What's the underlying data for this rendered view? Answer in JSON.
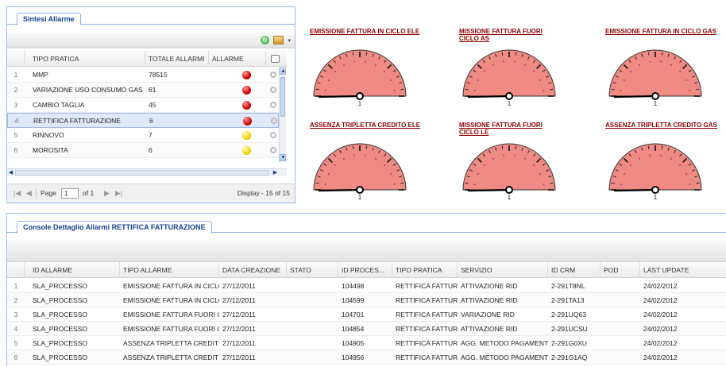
{
  "summary_panel": {
    "tab_label": "Sintesi Allarme",
    "columns": [
      "TIPO PRATICA",
      "TOTALE ALLARMI",
      "ALLARME"
    ],
    "rows": [
      {
        "n": "1",
        "tipo": "MMP",
        "totale": "78515",
        "level": "red"
      },
      {
        "n": "2",
        "tipo": "VARIAZIONE USO CONSUMO GAS",
        "totale": "61",
        "level": "red"
      },
      {
        "n": "3",
        "tipo": "CAMBIO TAGLIA",
        "totale": "45",
        "level": "red"
      },
      {
        "n": "4",
        "tipo": "RETTIFICA FATTURAZIONE",
        "totale": "6",
        "level": "red"
      },
      {
        "n": "5",
        "tipo": "RINNOVO",
        "totale": "7",
        "level": "yellow"
      },
      {
        "n": "6",
        "tipo": "MOROSITA",
        "totale": "6",
        "level": "yellow"
      }
    ],
    "selected_row": 3,
    "pager": {
      "page_label": "Page",
      "page_value": "1",
      "of_label": "of 1",
      "display": "Display - 15 of 15"
    },
    "icons": [
      "refresh-icon",
      "export-icon"
    ]
  },
  "gauges": [
    {
      "title": "EMISSIONE FATTURA IN CICLO ELE",
      "value": "1",
      "level": 0
    },
    {
      "title": "MISSIONE FATTURA FUORI CICLO AS",
      "value": "1",
      "level": 0
    },
    {
      "title": "EMISSIONE FATTURA IN CICLO GAS",
      "value": "1",
      "level": 0
    },
    {
      "title": "ASSENZA TRIPLETTA CREDITO ELE",
      "value": "1",
      "level": 0
    },
    {
      "title": "MISSIONE FATTURA FUORI CICLO LE",
      "value": "1",
      "level": 0
    },
    {
      "title": "ASSENZA TRIPLETTA CREDITO GAS",
      "value": "1",
      "level": 0
    }
  ],
  "detail_panel": {
    "tab_label": "Console Dettaglio Allarmi RETTIFICA FATTURAZIONE",
    "columns": [
      "ID ALLARME",
      "TIPO ALLARME",
      "DATA CREAZIONE",
      "STATO",
      "ID PROCES...",
      "TIPO PRATICA",
      "SERVIZIO",
      "ID CRM",
      "POD",
      "LAST UPDATE"
    ],
    "rows": [
      {
        "n": "1",
        "id": "SLA_PROCESSO",
        "tipo": "EMISSIONE FATTURA IN CICLO",
        "data": "27/12/2011",
        "stato": "",
        "proc": "104498",
        "pratica": "RETTIFICA FATTUR.",
        "servizio": "ATTIVAZIONE RID",
        "crm": "2-291T8NL",
        "pod": "",
        "update": "24/02/2012"
      },
      {
        "n": "2",
        "id": "SLA_PROCESSO",
        "tipo": "EMISSIONE FATTURA IN CICLO",
        "data": "27/12/2011",
        "stato": "",
        "proc": "104599",
        "pratica": "RETTIFICA FATTUR.",
        "servizio": "ATTIVAZIONE RID",
        "crm": "2-291TA13",
        "pod": "",
        "update": "24/02/2012"
      },
      {
        "n": "3",
        "id": "SLA_PROCESSO",
        "tipo": "EMISSIONE FATTURA FUORI C",
        "data": "27/12/2011",
        "stato": "",
        "proc": "104701",
        "pratica": "RETTIFICA FATTUR.",
        "servizio": "VARIAZIONE RID",
        "crm": "2-291UQ63",
        "pod": "",
        "update": "24/02/2012"
      },
      {
        "n": "4",
        "id": "SLA_PROCESSO",
        "tipo": "EMISSIONE FATTURA FUORI C",
        "data": "27/12/2011",
        "stato": "",
        "proc": "104854",
        "pratica": "RETTIFICA FATTUR.",
        "servizio": "ATTIVAZIONE RID",
        "crm": "2-291UCSU",
        "pod": "",
        "update": "24/02/2012"
      },
      {
        "n": "5",
        "id": "SLA_PROCESSO",
        "tipo": "ASSENZA TRIPLETTA CREDIT",
        "data": "27/12/2011",
        "stato": "",
        "proc": "104905",
        "pratica": "RETTIFICA FATTUR.",
        "servizio": "AGG. METODO PAGAMENTO",
        "crm": "2-291G0XU",
        "pod": "",
        "update": "24/02/2012"
      },
      {
        "n": "6",
        "id": "SLA_PROCESSO",
        "tipo": "ASSENZA TRIPLETTA CREDIT",
        "data": "27/12/2011",
        "stato": "",
        "proc": "104956",
        "pratica": "RETTIFICA FATTUR.",
        "servizio": "AGG. METODO PAGAMENTO",
        "crm": "2-291G1AQ",
        "pod": "",
        "update": "24/02/2012"
      }
    ]
  },
  "colors": {
    "gauge_fill": "#f08a84",
    "gauge_ticks": "#b84a6a",
    "title_red": "#8b0000",
    "border_blue": "#99bbe8",
    "alarm_red": "#d00000",
    "alarm_yellow": "#f5d400"
  }
}
